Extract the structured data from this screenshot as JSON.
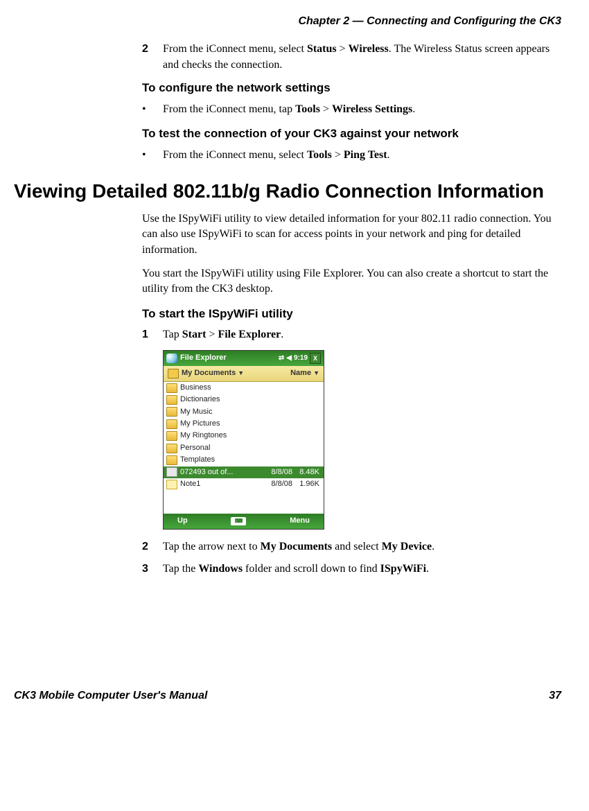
{
  "header": "Chapter 2 — Connecting and Configuring the CK3",
  "step2": {
    "num": "2",
    "text_before": "From the iConnect menu, select ",
    "b1": "Status",
    "mid1": " > ",
    "b2": "Wireless",
    "text_after": ". The Wireless Status screen appears and checks the connection."
  },
  "sub1": "To configure the network settings",
  "bullet1": {
    "text_before": "From the iConnect menu, tap ",
    "b1": "Tools",
    "mid": " > ",
    "b2": "Wireless Settings",
    "after": "."
  },
  "sub2": "To test the connection of your CK3 against your network",
  "bullet2": {
    "text_before": "From the iConnect menu, select ",
    "b1": "Tools",
    "mid": " > ",
    "b2": "Ping Test",
    "after": "."
  },
  "section_title": "Viewing Detailed 802.11b/g Radio Connection Information",
  "para1": "Use the ISpyWiFi utility to view detailed information for your 802.11 radio connection. You can also use ISpyWiFi to scan for access points in your network and ping for detailed information.",
  "para2": "You start the ISpyWiFi utility using File Explorer. You can also create a shortcut to start the utility from the CK3 desktop.",
  "sub3": "To start the ISpyWiFi utility",
  "step1b": {
    "num": "1",
    "text_before": "Tap ",
    "b1": "Start",
    "mid": " > ",
    "b2": "File Explorer",
    "after": "."
  },
  "screenshot": {
    "title": "File Explorer",
    "time": "9:19",
    "close": "X",
    "path": "My Documents",
    "dropdown_arrow": "▼",
    "sort": "Name",
    "folders": [
      "Business",
      "Dictionaries",
      "My Music",
      "My Pictures",
      "My Ringtones",
      "Personal",
      "Templates"
    ],
    "file1": {
      "name": "072493 out of...",
      "date": "8/8/08",
      "size": "8.48K"
    },
    "file2": {
      "name": "Note1",
      "date": "8/8/08",
      "size": "1.96K"
    },
    "bottom_left": "Up",
    "bottom_right": "Menu"
  },
  "step2b": {
    "num": "2",
    "text_before": "Tap the arrow next to ",
    "b1": "My Documents",
    "mid": " and select ",
    "b2": "My Device",
    "after": "."
  },
  "step3b": {
    "num": "3",
    "text_before": "Tap the ",
    "b1": "Windows",
    "mid": " folder and scroll down to find ",
    "b2": "ISpyWiFi",
    "after": "."
  },
  "footer_left": "CK3 Mobile Computer User's Manual",
  "footer_right": "37"
}
